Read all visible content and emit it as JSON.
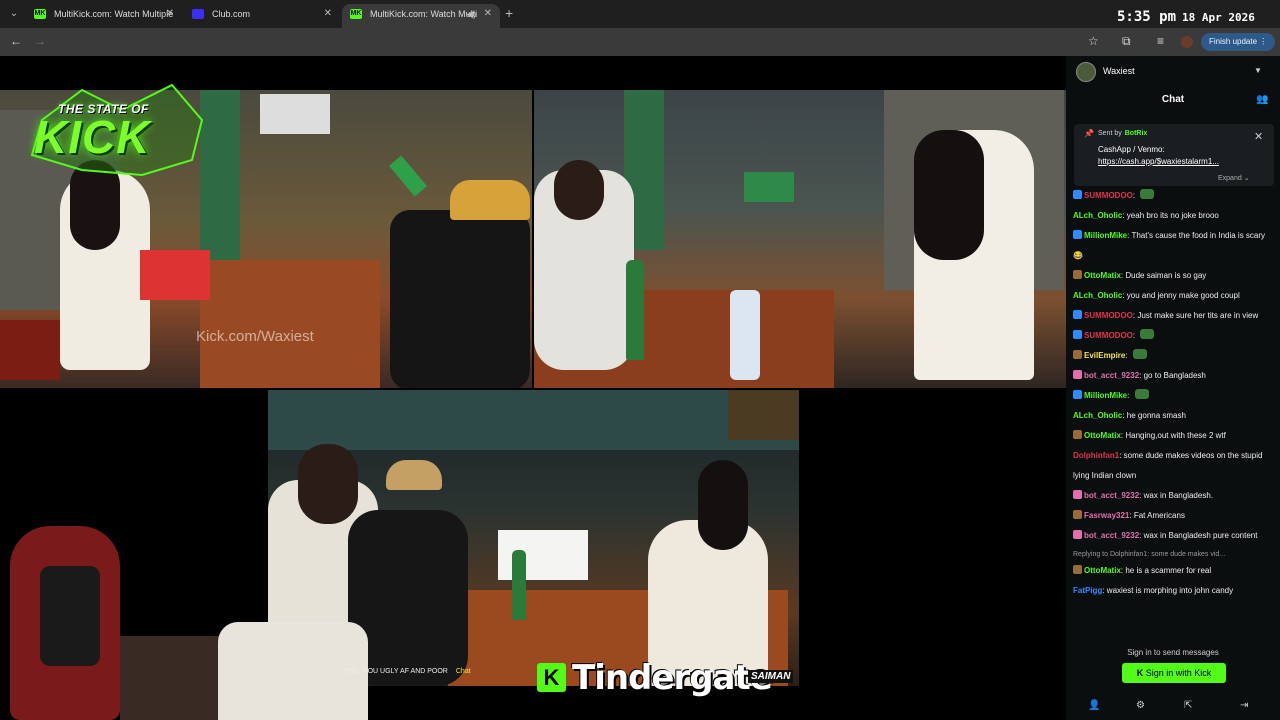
{
  "browser": {
    "tabs": [
      {
        "favicon": "MK",
        "title": "MultiKick.com: Watch Multiple"
      },
      {
        "favicon": "",
        "title": "Club.com"
      },
      {
        "favicon": "MK",
        "title": "MultiKick.com: Watch Multi"
      }
    ],
    "new_tab": "+",
    "clock_time": "5:35 pm",
    "clock_date": "18 Apr 2026",
    "finish_update": "Finish update",
    "colors": {
      "kick_green": "#53fc18",
      "chrome_dark": "#1f1f1f",
      "chrome_mid": "#3a3a3a"
    }
  },
  "stream": {
    "logo_top": "THE STATE OF",
    "logo_main": "KICK",
    "watermark": "Kick.com/Waxiest",
    "ticker": "YOU, YOU UGLY AF AND POOR",
    "ticker_chat": "Chat",
    "overlay_badge": "K",
    "overlay_title": "Tindergate",
    "overlay_sub": "SAIMAN"
  },
  "chat": {
    "channel_name": "Waxiest",
    "title": "Chat",
    "pinned": {
      "sent_by": "Sent by",
      "bot_name": "BotRix",
      "line1": "CashApp / Venmo:",
      "line2": "https://cash.app/$waxiestalarm1...",
      "expand": "Expand"
    },
    "messages": [
      {
        "user": "SUMMODOO",
        "color": "#e0334a",
        "text": "",
        "badge": "b-blue",
        "emote": true
      },
      {
        "user": "ALch_Oholic",
        "color": "#53fc18",
        "text": "yeah bro its no joke brooo"
      },
      {
        "user": "MillionMike",
        "color": "#53fc18",
        "text": "That's cause the food in India is scary 😂",
        "badge": "b-blue",
        "wrap": true
      },
      {
        "user": "OttoMatix",
        "color": "#53fc18",
        "text": "Dude saiman is so gay",
        "badge": "b-brown"
      },
      {
        "user": "ALch_Oholic",
        "color": "#53fc18",
        "text": "you and jenny make good coupl"
      },
      {
        "user": "SUMMODOO",
        "color": "#e0334a",
        "text": "Just make sure her tits are in view",
        "badge": "b-blue",
        "wrap": true
      },
      {
        "user": "SUMMODOO",
        "color": "#e0334a",
        "text": "",
        "badge": "b-blue",
        "emote": true
      },
      {
        "user": "EvilEmpire",
        "color": "#f5e34a",
        "text": "",
        "badge": "b-brown",
        "emote": true
      },
      {
        "user": "bot_acct_9232",
        "color": "#e46fb0",
        "text": "go to Bangladesh",
        "badge": "b-pink"
      },
      {
        "user": "MillionMike",
        "color": "#53fc18",
        "text": "",
        "badge": "b-blue",
        "emote": true
      },
      {
        "user": "ALch_Oholic",
        "color": "#53fc18",
        "text": "he gonna smash"
      },
      {
        "user": "OttoMatix",
        "color": "#53fc18",
        "text": "Hanging,out with these 2 wtf",
        "badge": "b-brown"
      },
      {
        "user": "Dolphinfan1",
        "color": "#e0334a",
        "text": "some dude makes videos on the stupid lying Indian clown",
        "wrap": true
      },
      {
        "user": "bot_acct_9232",
        "color": "#e46fb0",
        "text": "wax in Bangladesh.",
        "badge": "b-pink"
      },
      {
        "user": "Fasrway321",
        "color": "#e46fb0",
        "text": "Fat Americans",
        "badge": "b-brown"
      },
      {
        "user": "bot_acct_9232",
        "color": "#e46fb0",
        "text": "wax in Bangladesh pure content",
        "badge": "b-pink",
        "wrap": true
      }
    ],
    "reply_to": "Replying to Dolphinfan1: some dude makes vid...",
    "messages_after": [
      {
        "user": "OttoMatix",
        "color": "#53fc18",
        "text": "he is a scammer for real",
        "badge": "b-brown"
      },
      {
        "user": "FatPigg",
        "color": "#2f8bff",
        "text": "waxiest is morphing into john candy"
      }
    ],
    "signin_text": "Sign in to send messages",
    "signin_button": "Sign in with Kick"
  }
}
